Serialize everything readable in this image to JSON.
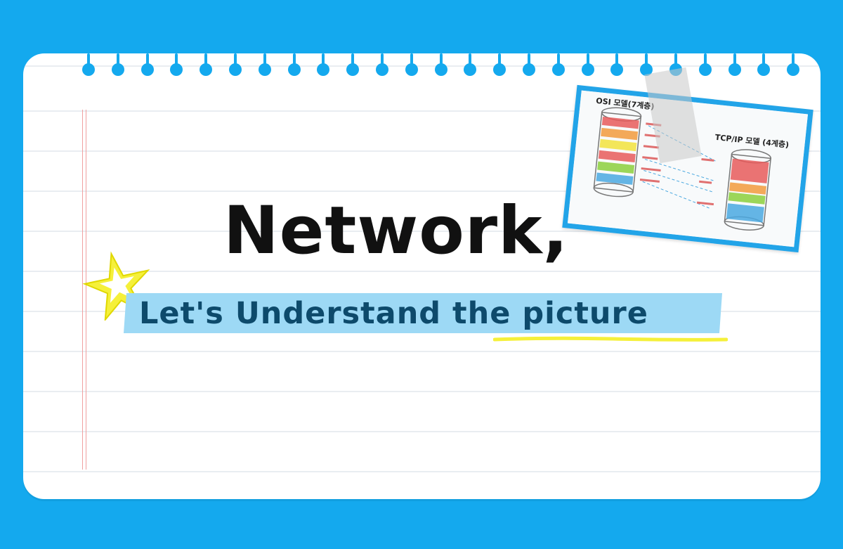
{
  "title": "Network,",
  "subtitle": "Let's Understand the picture",
  "diagram": {
    "osi_label": "OSI 모델(7계층)",
    "tcp_label": "TCP/IP 모델 (4계층)"
  },
  "colors": {
    "background": "#14a9ee",
    "card": "#ffffff",
    "ribbon": "#9dd9f5",
    "subtitle_text": "#0d4a6b",
    "highlight": "#f5f03a",
    "star": "#f5f03a"
  },
  "icons": [
    "star-icon",
    "tape-icon"
  ]
}
